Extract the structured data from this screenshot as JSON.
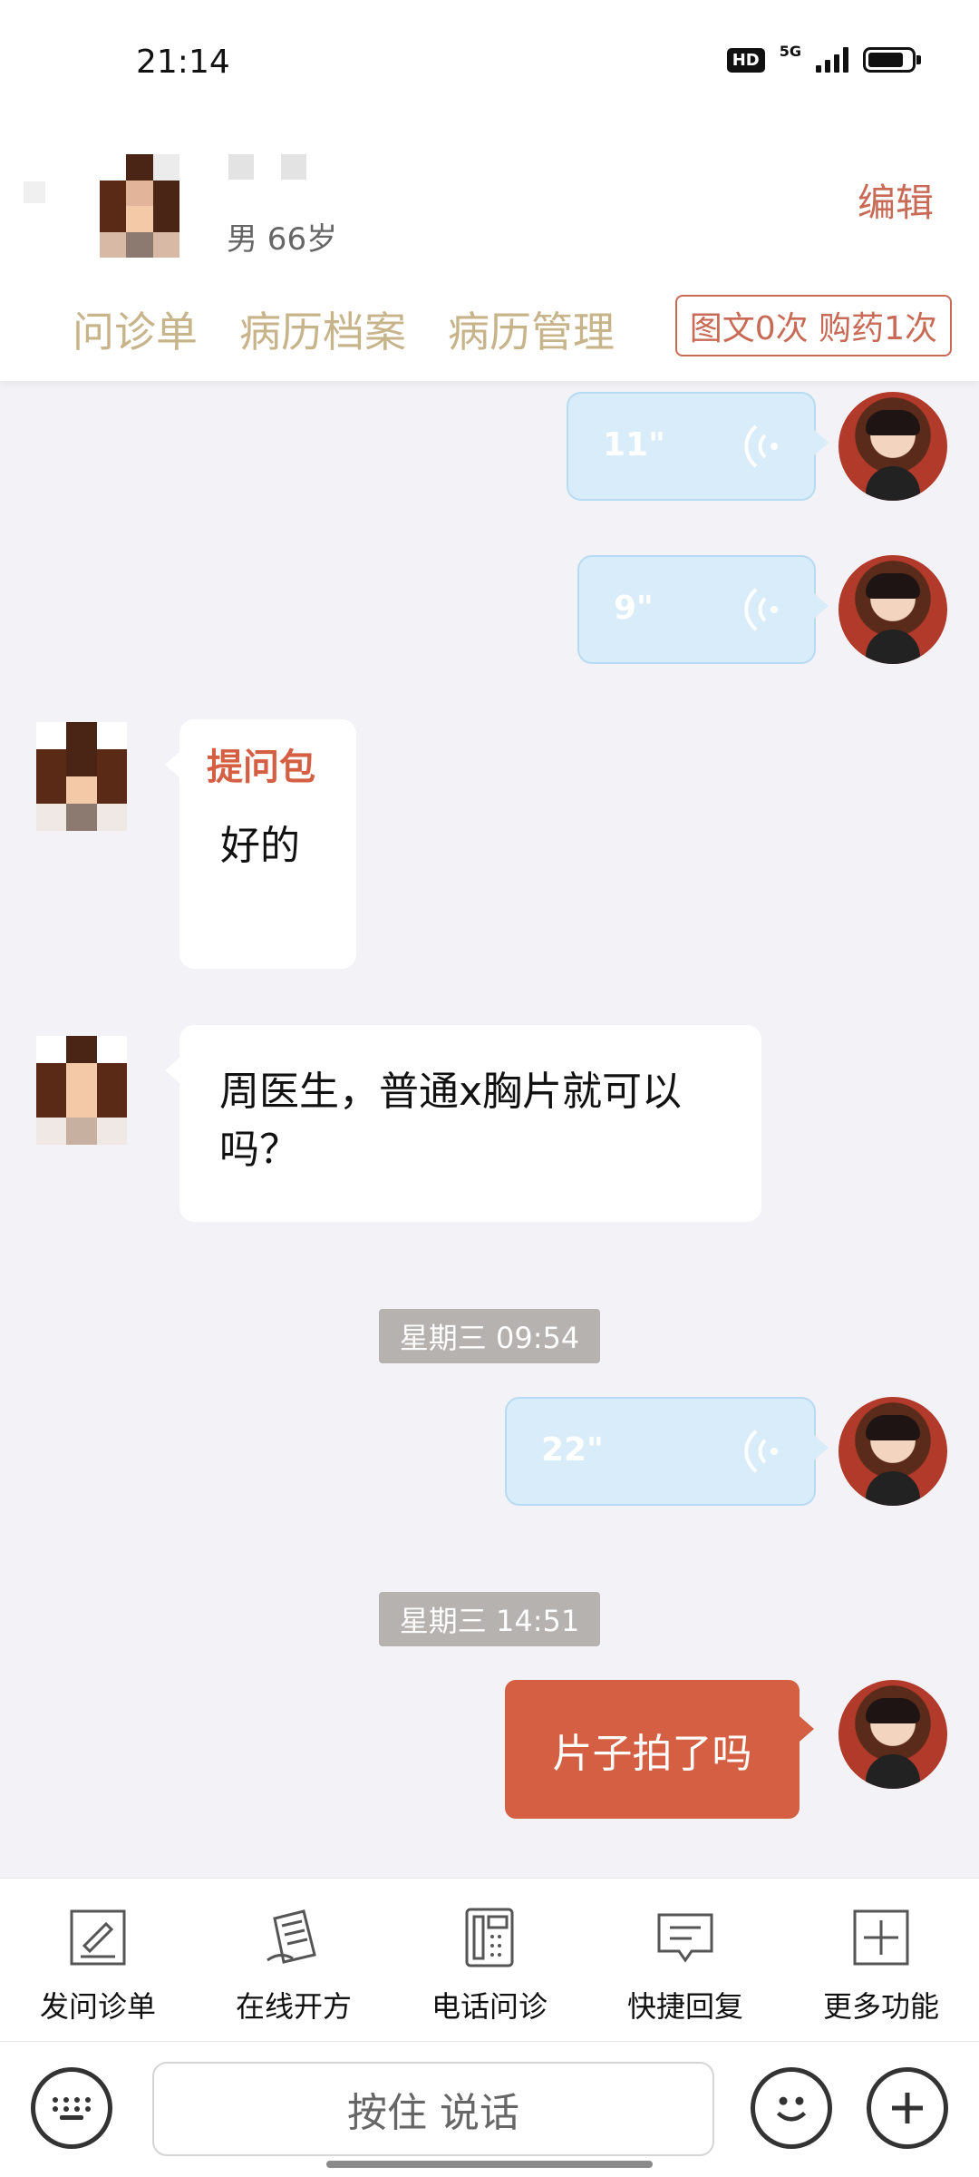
{
  "status_bar": {
    "time": "21:14",
    "hd": "HD",
    "network": "5G"
  },
  "header": {
    "patient": "男 66岁",
    "edit": "编辑",
    "tabs": [
      "问诊单",
      "病历档案",
      "病历管理"
    ],
    "quota": "图文0次 购药1次"
  },
  "chat": {
    "voice_1": "11\"",
    "voice_2": "9\"",
    "msg_1_tag": "提问包",
    "msg_1_text": "好的",
    "msg_2_text": "周医生，普通x胸片就可以吗？",
    "timestamp_1": "星期三 09:54",
    "voice_3": "22\"",
    "timestamp_2": "星期三 14:51",
    "msg_3_text": "片子拍了吗"
  },
  "functions": [
    {
      "label": "发问诊单",
      "icon": "form-icon"
    },
    {
      "label": "在线开方",
      "icon": "prescription-icon"
    },
    {
      "label": "电话问诊",
      "icon": "phone-icon"
    },
    {
      "label": "快捷回复",
      "icon": "quick-reply-icon"
    },
    {
      "label": "更多功能",
      "icon": "more-icon"
    }
  ],
  "input": {
    "talk_button": "按住 说话"
  }
}
